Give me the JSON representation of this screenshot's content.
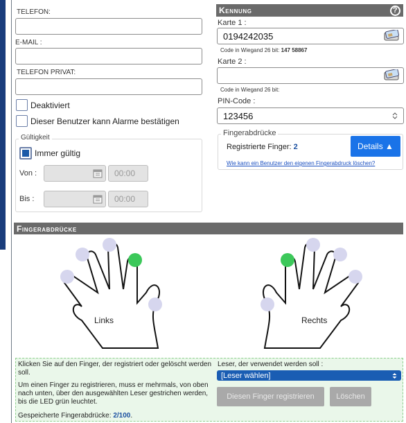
{
  "contact": {
    "telefon_label": "TELEFON:",
    "telefon_value": "",
    "email_label": "E-MAIL :",
    "email_value": "",
    "telefon_privat_label": "TELEFON PRIVAT:",
    "telefon_privat_value": ""
  },
  "options": {
    "deaktiviert": "Deaktiviert",
    "alarme": "Dieser Benutzer kann Alarme bestätigen"
  },
  "validity": {
    "legend": "Gültigkeit",
    "immer_gueltig": "Immer gültig",
    "von_label": "Von :",
    "bis_label": "Bis :",
    "von_time": "00:00",
    "bis_time": "00:00"
  },
  "kennung": {
    "header": "Kennung",
    "help": "?",
    "karte1_label": "Karte 1 :",
    "karte1_value": "0194242035",
    "karte1_wiegand_label": "Code in Wiegand 26 bit:",
    "karte1_wiegand_value": "147 58867",
    "karte2_label": "Karte 2 :",
    "karte2_value": "",
    "karte2_wiegand_label": "Code in Wiegand 26 bit:",
    "pin_label": "PIN-Code :",
    "pin_value": "123456"
  },
  "fingerprints_box": {
    "legend": "Fingerabdrücke",
    "registered_label": "Registrierte Finger:",
    "registered_count": "2",
    "details_button": "Details ▲",
    "delete_link": "Wie kann ein Benutzer den eigenen Fingerabdruck löschen?"
  },
  "fingerprints_section": {
    "header": "Fingerabdrücke",
    "left_hand": "Links",
    "right_hand": "Rechts",
    "colors": {
      "registered": "#3cc85a",
      "available": "#d6d6ee",
      "outline": "#111111"
    }
  },
  "instructions": {
    "line1": "Klicken Sie auf den Finger, der registriert oder gelöscht werden soll.",
    "line2": "Um einen Finger zu registrieren, muss er mehrmals, von oben nach unten, über den ausgewählten Leser gestrichen werden, bis die LED grün leuchtet.",
    "saved_label": "Gespeicherte Fingerabdrücke:",
    "saved_value": "2/100",
    "saved_suffix": ".",
    "reader_label": "Leser, der verwendet werden soll :",
    "reader_select": "[Leser wählen]",
    "register_button": "Diesen Finger registrieren",
    "delete_button": "Löschen"
  }
}
